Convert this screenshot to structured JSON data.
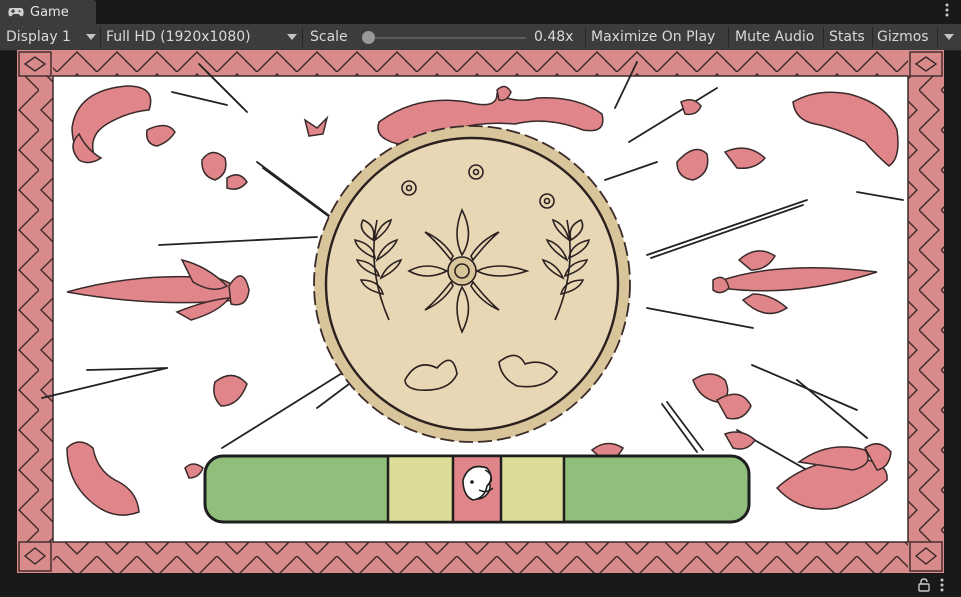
{
  "tab": {
    "icon": "gamepad-icon",
    "label": "Game"
  },
  "toolbar": {
    "display": "Display 1",
    "resolution": "Full HD (1920x1080)",
    "scale_label": "Scale",
    "scale_value": "0.48x",
    "scale_fraction": 0.02,
    "maximize": "Maximize On Play",
    "mute": "Mute Audio",
    "stats": "Stats",
    "gizmos": "Gizmos"
  },
  "colors": {
    "editor_bg": "#191919",
    "toolbar_bg": "#3c3c3c",
    "border_pink": "#d98a8a",
    "plate_fill": "#e8d7b4",
    "bar_green": "#8fbf7a",
    "bar_yellow": "#dcdb97"
  },
  "status": {
    "lock_icon": "lock-icon",
    "menu_icon": "kebab-menu-icon"
  }
}
